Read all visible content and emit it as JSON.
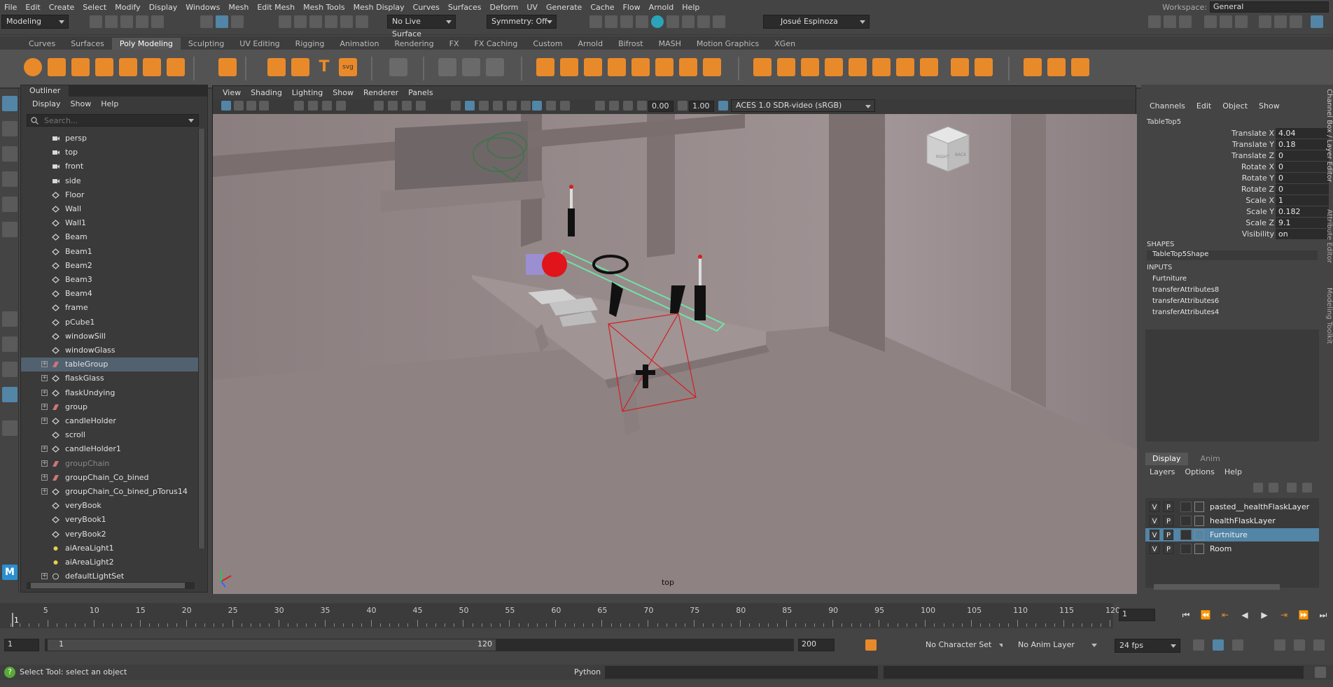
{
  "menubar": {
    "items": [
      "File",
      "Edit",
      "Create",
      "Select",
      "Modify",
      "Display",
      "Windows",
      "Mesh",
      "Edit Mesh",
      "Mesh Tools",
      "Mesh Display",
      "Curves",
      "Surfaces",
      "Deform",
      "UV",
      "Generate",
      "Cache",
      "Flow",
      "Arnold",
      "Help"
    ],
    "workspace_label": "Workspace:",
    "workspace_value": "General"
  },
  "statusline": {
    "mode": "Modeling",
    "live_surface": "No Live Surface",
    "symmetry": "Symmetry: Off",
    "user": "Josué Espinoza"
  },
  "shelf": {
    "tabs": [
      "Curves",
      "Surfaces",
      "Poly Modeling",
      "Sculpting",
      "UV Editing",
      "Rigging",
      "Animation",
      "Rendering",
      "FX",
      "FX Caching",
      "Custom",
      "Arnold",
      "Bifrost",
      "MASH",
      "Motion Graphics",
      "XGen"
    ],
    "active": "Poly Modeling"
  },
  "outliner": {
    "title": "Outliner",
    "menu": [
      "Display",
      "Show",
      "Help"
    ],
    "search_placeholder": "Search...",
    "items": [
      {
        "name": "persp",
        "type": "camera",
        "expand": false
      },
      {
        "name": "top",
        "type": "camera",
        "expand": false
      },
      {
        "name": "front",
        "type": "camera",
        "expand": false
      },
      {
        "name": "side",
        "type": "camera",
        "expand": false
      },
      {
        "name": "Floor",
        "type": "mesh",
        "expand": false
      },
      {
        "name": "Wall",
        "type": "mesh",
        "expand": false
      },
      {
        "name": "Wall1",
        "type": "mesh",
        "expand": false
      },
      {
        "name": "Beam",
        "type": "mesh",
        "expand": false
      },
      {
        "name": "Beam1",
        "type": "mesh",
        "expand": false
      },
      {
        "name": "Beam2",
        "type": "mesh",
        "expand": false
      },
      {
        "name": "Beam3",
        "type": "mesh",
        "expand": false
      },
      {
        "name": "Beam4",
        "type": "mesh",
        "expand": false
      },
      {
        "name": "frame",
        "type": "mesh",
        "expand": false
      },
      {
        "name": "pCube1",
        "type": "mesh",
        "expand": false
      },
      {
        "name": "windowSill",
        "type": "mesh",
        "expand": false
      },
      {
        "name": "windowGlass",
        "type": "mesh",
        "expand": false
      },
      {
        "name": "tableGroup",
        "type": "group",
        "expand": true,
        "selected": true
      },
      {
        "name": "flaskGlass",
        "type": "mesh",
        "expand": true
      },
      {
        "name": "flaskUndying",
        "type": "mesh",
        "expand": true
      },
      {
        "name": "group",
        "type": "group",
        "expand": true
      },
      {
        "name": "candleHolder",
        "type": "mesh",
        "expand": true
      },
      {
        "name": "scroll",
        "type": "mesh",
        "expand": false
      },
      {
        "name": "candleHolder1",
        "type": "mesh",
        "expand": true
      },
      {
        "name": "groupChain",
        "type": "group",
        "expand": true,
        "dim": true
      },
      {
        "name": "groupChain_Co_bined",
        "type": "group",
        "expand": true
      },
      {
        "name": "groupChain_Co_bined_pTorus14",
        "type": "mesh",
        "expand": true
      },
      {
        "name": "veryBook",
        "type": "mesh",
        "expand": false
      },
      {
        "name": "veryBook1",
        "type": "mesh",
        "expand": false
      },
      {
        "name": "veryBook2",
        "type": "mesh",
        "expand": false
      },
      {
        "name": "aiAreaLight1",
        "type": "light",
        "expand": false
      },
      {
        "name": "aiAreaLight2",
        "type": "light",
        "expand": false
      },
      {
        "name": "defaultLightSet",
        "type": "set",
        "expand": true
      }
    ]
  },
  "viewport": {
    "menu": [
      "View",
      "Shading",
      "Lighting",
      "Show",
      "Renderer",
      "Panels"
    ],
    "exposure": "0.00",
    "gamma": "1.00",
    "colorspace": "ACES 1.0 SDR-video (sRGB)",
    "camera_label": "top",
    "viewcube_right": "RIGHT",
    "viewcube_back": "BACK"
  },
  "channelbox": {
    "menu": [
      "Channels",
      "Edit",
      "Object",
      "Show"
    ],
    "object": "TableTop5",
    "attrs": [
      {
        "label": "Translate X",
        "value": "4.04"
      },
      {
        "label": "Translate Y",
        "value": "0.18"
      },
      {
        "label": "Translate Z",
        "value": "0"
      },
      {
        "label": "Rotate X",
        "value": "0"
      },
      {
        "label": "Rotate Y",
        "value": "0"
      },
      {
        "label": "Rotate Z",
        "value": "0"
      },
      {
        "label": "Scale X",
        "value": "1"
      },
      {
        "label": "Scale Y",
        "value": "0.182"
      },
      {
        "label": "Scale Z",
        "value": "9.1"
      },
      {
        "label": "Visibility",
        "value": "on"
      }
    ],
    "shapes_label": "SHAPES",
    "shape": "TableTop5Shape",
    "inputs_label": "INPUTS",
    "inputs": [
      "Furtniture",
      "transferAttributes8",
      "transferAttributes6",
      "transferAttributes4"
    ],
    "side_tabs": [
      "Channel Box / Layer Editor",
      "Attribute Editor",
      "Modeling Toolkit"
    ]
  },
  "layers": {
    "tabs": [
      "Display",
      "Anim"
    ],
    "active_tab": "Display",
    "menu": [
      "Layers",
      "Options",
      "Help"
    ],
    "rows": [
      {
        "v": "V",
        "p": "P",
        "name": "pasted__healthFlaskLayer"
      },
      {
        "v": "V",
        "p": "P",
        "name": "healthFlaskLayer"
      },
      {
        "v": "V",
        "p": "P",
        "name": "Furtniture",
        "selected": true
      },
      {
        "v": "V",
        "p": "P",
        "name": "Room"
      }
    ]
  },
  "timeline": {
    "ticks": [
      "5",
      "10",
      "15",
      "20",
      "25",
      "30",
      "35",
      "40",
      "45",
      "50",
      "55",
      "60",
      "65",
      "70",
      "75",
      "80",
      "85",
      "90",
      "95",
      "100",
      "105",
      "110",
      "115",
      "120"
    ],
    "current_frame_marker": "1",
    "current_frame": "1"
  },
  "range": {
    "start": "1",
    "range_start": "1",
    "range_end": "120",
    "end": "200",
    "character_set": "No Character Set",
    "anim_layer": "No Anim Layer",
    "fps": "24 fps"
  },
  "cmdline": {
    "help": "Select Tool: select an object",
    "lang": "Python"
  },
  "colors": {
    "accent_orange": "#e98a2a",
    "selection_blue": "#52616f",
    "layer_select": "#5285a6",
    "manipulator_red": "#d22020",
    "wire_green": "#6fe3a5"
  }
}
